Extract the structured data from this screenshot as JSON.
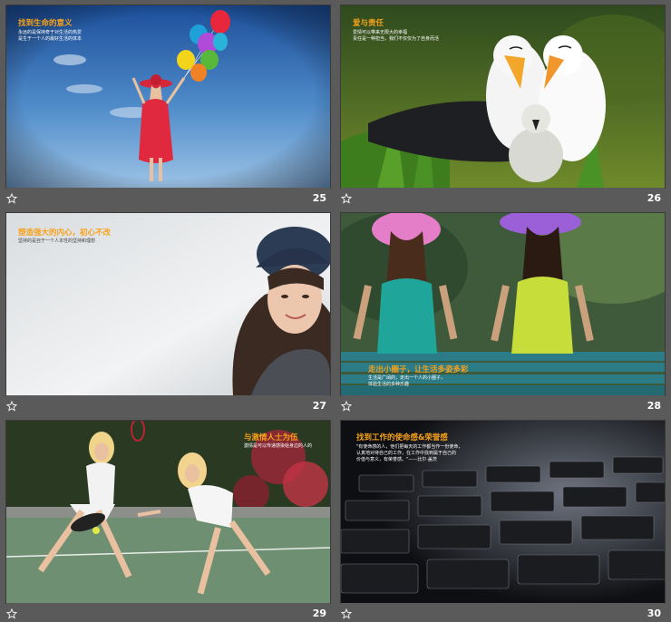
{
  "slides": [
    {
      "num": "25",
      "title": "找到生命的意义",
      "lines": [
        "永远的是保持奇于对生活的热爱",
        "是生于一个人的最好生活的体本"
      ]
    },
    {
      "num": "26",
      "title": "爱与责任",
      "lines": [
        "爱情可以带来无限大的幸福",
        "责任是一种担当，我们不仅仅为了自身而活"
      ]
    },
    {
      "num": "27",
      "title": "塑造强大的内心，初心不改",
      "lines": [
        "坚持的是自于一个人本性的坚持和理想"
      ]
    },
    {
      "num": "28",
      "title": "走出小圈子，让生活多姿多彩",
      "lines": [
        "生活是广阔的，走出一个人的小圈子，",
        "体验生活的多种乐趣"
      ]
    },
    {
      "num": "29",
      "title": "与激情人士为伍",
      "lines": [
        "激情是可以传递感染给身边的人的"
      ]
    },
    {
      "num": "30",
      "title": "找到工作的使命感&荣誉感",
      "lines": [
        "\"有使命感的人，他们把每天的工作都当作一份使命，",
        "认真地对待自己的工作，在工作中找到属于自己的",
        "价值与意义，有荣誉感。\"——比尔·盖茨"
      ]
    }
  ],
  "colors": {
    "background": "#5a5a5a",
    "title_accent": "#f7a21b"
  },
  "icons": {
    "star": "star-icon"
  }
}
